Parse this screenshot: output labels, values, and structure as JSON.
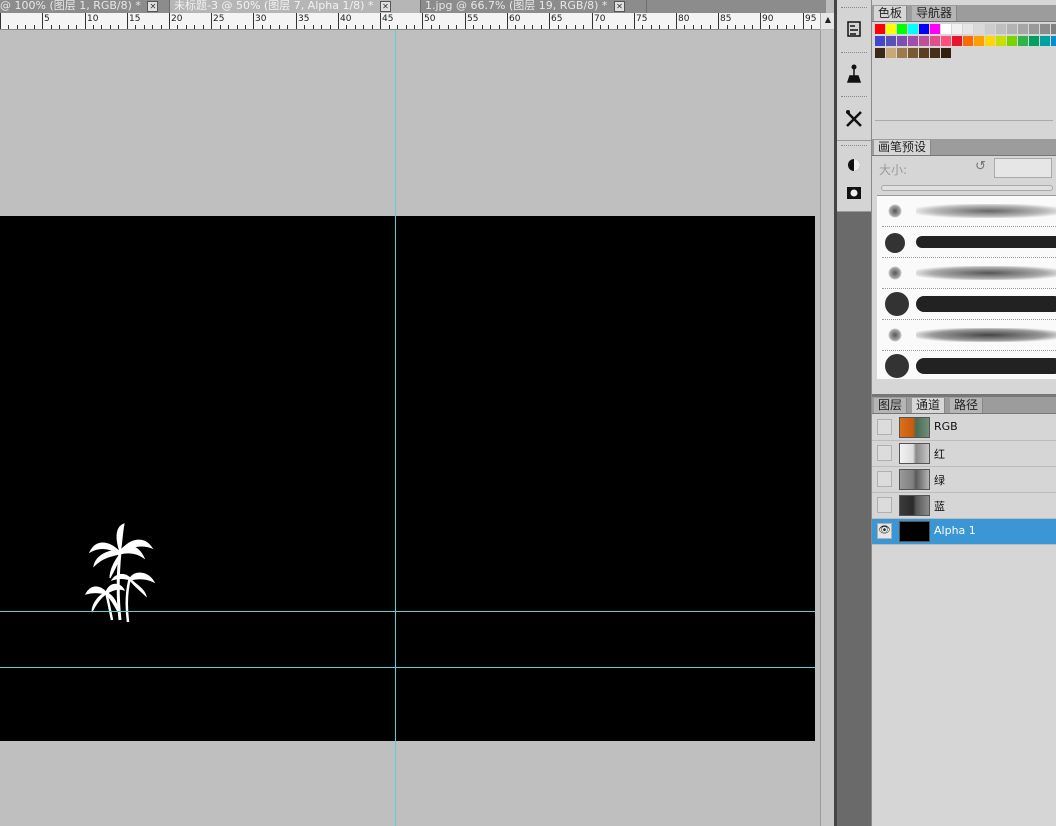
{
  "doc_tabs": [
    {
      "title": "@ 100% (图层 1, RGB/8) *",
      "active": false
    },
    {
      "title": "未标题-3 @ 50% (图层 7, Alpha 1/8) *",
      "active": true
    },
    {
      "title": "1.jpg @ 66.7% (图层 19, RGB/8) *",
      "active": false
    }
  ],
  "tab_close_glyph": "✕",
  "ruler": {
    "labels": [
      "5",
      "10",
      "15",
      "20",
      "25",
      "30",
      "35",
      "40",
      "45",
      "50",
      "55",
      "60",
      "65",
      "70",
      "75",
      "80",
      "85",
      "90",
      "95"
    ],
    "corner": "▲"
  },
  "swatch_panel": {
    "tabs": [
      "色板",
      "导航器"
    ],
    "row1_colors": [
      "#ff0000",
      "#ffff00",
      "#00ff00",
      "#00ffff",
      "#0000ff",
      "#ff00ff",
      "#ffffff",
      "#f2f2f2",
      "#e6e6e6",
      "#d9d9d9",
      "#cccccc",
      "#bfbfbf",
      "#b3b3b3",
      "#a6a6a6",
      "#999999",
      "#8c8c8c",
      "#808080"
    ],
    "row2_colors": [
      "#3f48cc",
      "#5b4fb5",
      "#7d4fb0",
      "#a04fa8",
      "#c04f9a",
      "#e0508c",
      "#ff4f7a",
      "#e8142c",
      "#ff6a00",
      "#ff9e00",
      "#ffd800",
      "#c8e000",
      "#7ad400",
      "#2fb34a",
      "#00a060",
      "#00a0a0",
      "#0090d0"
    ],
    "row3_colors": [
      "#3b2a1a",
      "#c8a878",
      "#9c7a4a",
      "#7a5a32",
      "#5c3f20",
      "#46301a",
      "#32200f"
    ]
  },
  "brush_panel": {
    "tab": "画笔预设",
    "size_label": "大小:",
    "reset_icon": "↺"
  },
  "channels_panel": {
    "tabs": [
      "图层",
      "通道",
      "路径"
    ],
    "eye_glyph": "👁",
    "rows": [
      {
        "name": "RGB",
        "selected": false,
        "visible": false
      },
      {
        "name": "红",
        "selected": false,
        "visible": false
      },
      {
        "name": "绿",
        "selected": false,
        "visible": false
      },
      {
        "name": "蓝",
        "selected": false,
        "visible": false
      },
      {
        "name": "Alpha 1",
        "selected": true,
        "visible": true
      }
    ]
  },
  "tool_icons": [
    "history-brush-icon",
    "clone-stamp-icon",
    "tools-cross-icon",
    "color-circle-icon",
    "quick-mask-icon"
  ]
}
